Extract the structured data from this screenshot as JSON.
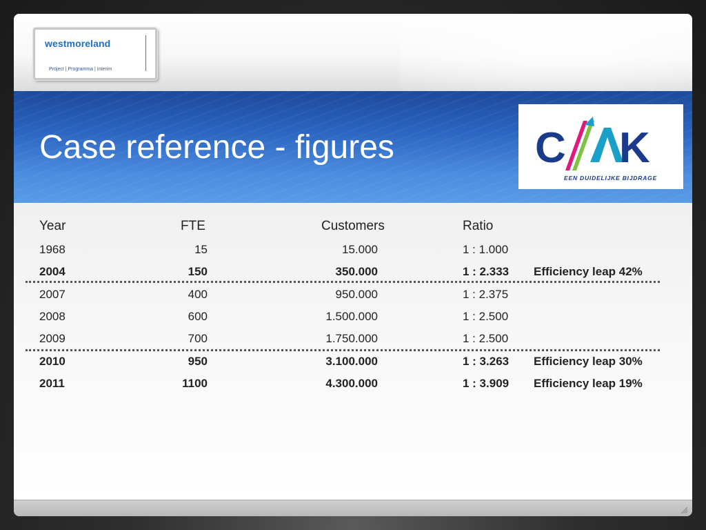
{
  "header": {
    "logo": {
      "name": "westmoreland",
      "tagline": "Project | Programma | Interim"
    }
  },
  "title": "Case reference - figures",
  "cak_logo": {
    "text": "C/AK",
    "tagline": "EEN DUIDELIJKE BIJDRAGE",
    "colors": {
      "navy": "#1a3a8c",
      "pink": "#e0197d",
      "green": "#7fc241",
      "teal": "#1aa0c8"
    }
  },
  "table": {
    "headers": {
      "year": "Year",
      "fte": "FTE",
      "customers": "Customers",
      "ratio": "Ratio"
    },
    "rows": [
      {
        "year": "1968",
        "fte": "15",
        "customers": "15.000",
        "ratio": "1 : 1.000",
        "note": "",
        "bold": false
      },
      {
        "year": "2004",
        "fte": "150",
        "customers": "350.000",
        "ratio": "1 : 2.333",
        "note": "Efficiency leap 42%",
        "bold": true
      },
      {
        "year": "2007",
        "fte": "400",
        "customers": "950.000",
        "ratio": "1 : 2.375",
        "note": "",
        "bold": false
      },
      {
        "year": "2008",
        "fte": "600",
        "customers": "1.500.000",
        "ratio": "1 : 2.500",
        "note": "",
        "bold": false
      },
      {
        "year": "2009",
        "fte": "700",
        "customers": "1.750.000",
        "ratio": "1 : 2.500",
        "note": "",
        "bold": false
      },
      {
        "year": "2010",
        "fte": "950",
        "customers": "3.100.000",
        "ratio": "1 : 3.263",
        "note": "Efficiency leap 30%",
        "bold": true
      },
      {
        "year": "2011",
        "fte": "1100",
        "customers": "4.300.000",
        "ratio": "1 : 3.909",
        "note": "Efficiency leap 19%",
        "bold": true
      }
    ]
  },
  "colors": {
    "title_band": "#2a63c0",
    "text": "#222222",
    "divider": "#555555"
  }
}
